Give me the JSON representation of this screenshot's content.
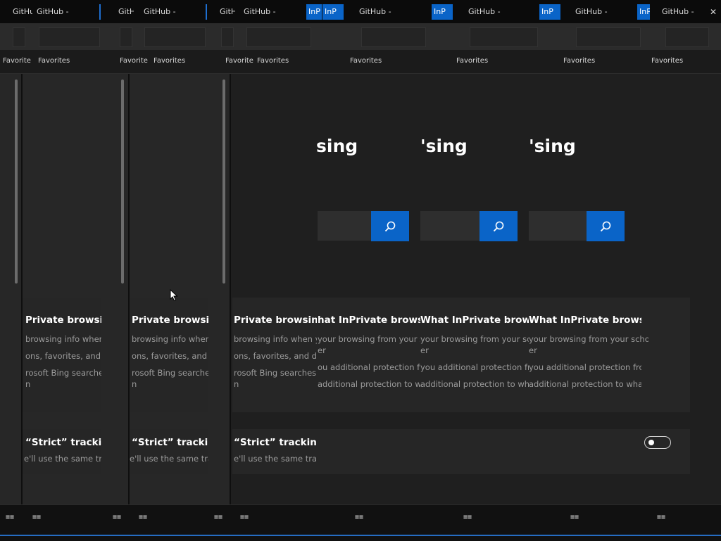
{
  "tabs": {
    "label": "GitHub -",
    "short_label": "GitHub",
    "active_label": "InP"
  },
  "favorites": {
    "label": "Favorites"
  },
  "page": {
    "title_fragment": "sing",
    "title_fragment_alt": "'sing"
  },
  "search": {
    "placeholder": ""
  },
  "card1": {
    "title_variants": [
      "Private browsing",
      "Private browsing d",
      "hat InPrivate browsing",
      "What InPrivate browsing",
      "What InPrivate browsing d"
    ],
    "line1_left": "browsing info when y",
    "line1_left_alt": "browsing info when yo",
    "line1_right": "your browsing from your sch",
    "line1_right_last": "your browsing from your schoo",
    "line1b": "er",
    "line2_left": "ons, favorites, and do",
    "line2_left_alt": "ons, favorites, and dow",
    "line2_right": "ou additional protection fro",
    "line2_right_alt": "you additional protection fro",
    "line2_right_last": "you additional protection fron",
    "line3_left": "rosoft Bing searches t",
    "line3_left_alt": "rosoft Bing searches fro",
    "line3_right": "additional protection to what",
    "line3_right_last": "additional protection to what's",
    "line4_left": "n"
  },
  "card2": {
    "title": "“Strict” tracking p",
    "title_alt": "“Strict” tracking pr",
    "subtitle": "e'll use the same tra",
    "subtitle_alt": "e'll use the same track",
    "toggle_on": false
  },
  "taskbar": {
    "icon_glyph": "≡≡"
  },
  "colors": {
    "accent": "#0a64c8",
    "background": "#1f1f1f",
    "card": "#262626"
  }
}
